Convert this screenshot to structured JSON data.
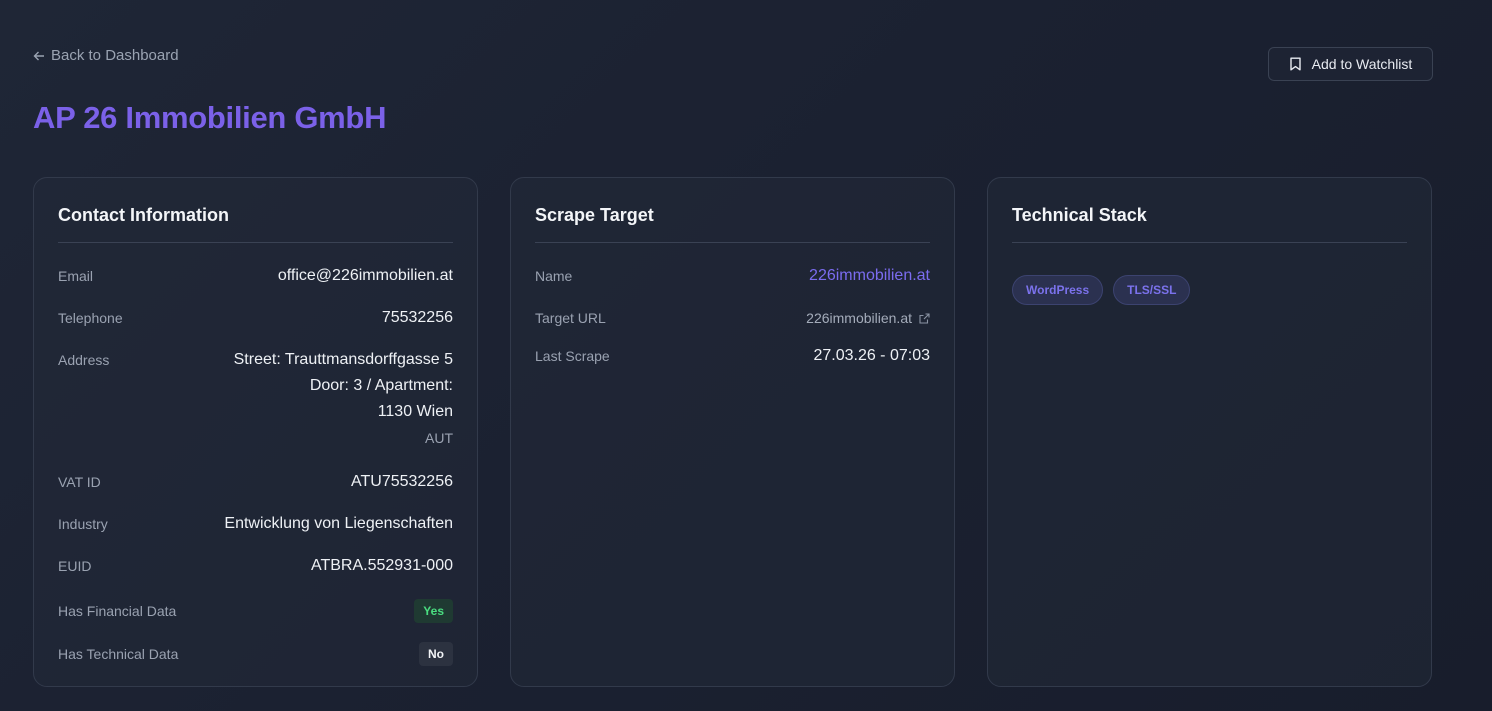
{
  "nav": {
    "back_label": "Back to Dashboard"
  },
  "header": {
    "title": "AP 26 Immobilien GmbH",
    "watchlist_label": "Add to Watchlist"
  },
  "contact": {
    "title": "Contact Information",
    "email_label": "Email",
    "email": "office@226immobilien.at",
    "telephone_label": "Telephone",
    "telephone": "75532256",
    "address_label": "Address",
    "address_street": "Street: Trauttmansdorffgasse 5",
    "address_door": "Door: 3 / Apartment:",
    "address_city": "1130 Wien",
    "address_country": "AUT",
    "vat_label": "VAT ID",
    "vat": "ATU75532256",
    "industry_label": "Industry",
    "industry": "Entwicklung von Liegenschaften",
    "euid_label": "EUID",
    "euid": "ATBRA.552931-000",
    "financial_label": "Has Financial Data",
    "financial": "Yes",
    "technical_label": "Has Technical Data",
    "technical": "No"
  },
  "scrape": {
    "title": "Scrape Target",
    "name_label": "Name",
    "name": "226immobilien.at",
    "url_label": "Target URL",
    "url": "226immobilien.at",
    "last_label": "Last Scrape",
    "last": "27.03.26 - 07:03"
  },
  "tech": {
    "title": "Technical Stack",
    "tags": [
      "WordPress",
      "TLS/SSL"
    ]
  },
  "colors": {
    "accent": "#7b61e8",
    "success": "#4ade80",
    "background": "#1d2333"
  }
}
